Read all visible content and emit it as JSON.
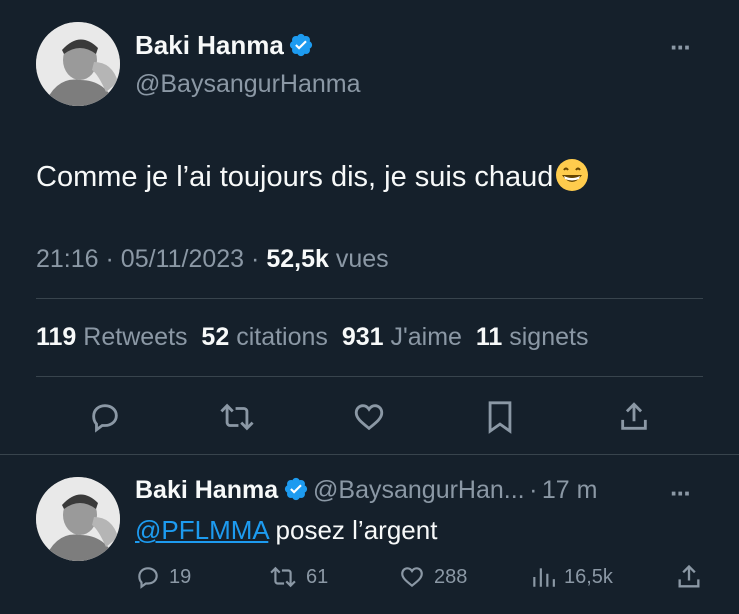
{
  "tweet": {
    "author_name": "Baki Hanma",
    "author_handle": "@BaysangurHanma",
    "text": "Comme je l’ai toujours dis, je suis chaud",
    "emoji": "😁",
    "time": "21:16",
    "date": "05/11/2023",
    "separator": "·",
    "views_count": "52,5k",
    "views_label": "vues",
    "stats": {
      "retweets_count": "119",
      "retweets_label": "Retweets",
      "quotes_count": "52",
      "quotes_label": "citations",
      "likes_count": "931",
      "likes_label": "J'aime",
      "bookmarks_count": "11",
      "bookmarks_label": "signets"
    },
    "more_label": "···"
  },
  "reply": {
    "author_name": "Baki Hanma",
    "author_handle": "@BaysangurHan...",
    "separator": "·",
    "time_ago": "17 m",
    "mention": "@PFLMMA",
    "text": "posez l’argent",
    "more_label": "···",
    "replies": "19",
    "retweets": "61",
    "likes": "288",
    "views": "16,5k"
  },
  "colors": {
    "background": "#15202b",
    "accent": "#1d9bf0",
    "muted": "#8b98a5",
    "divider": "#38444d"
  }
}
